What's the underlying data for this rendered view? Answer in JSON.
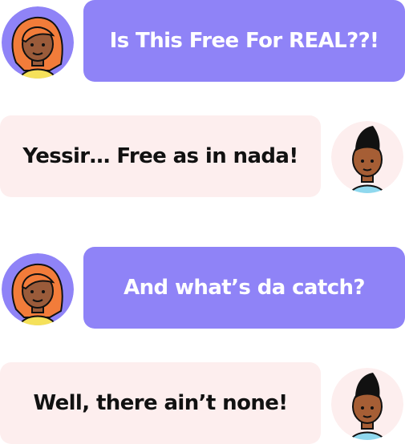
{
  "colors": {
    "girl_bubble": "#8f83f7",
    "boy_bubble": "#fdeeee",
    "girl_avatar_bg": "#8f83f7",
    "boy_avatar_bg": "#fdeeee",
    "girl_text": "#ffffff",
    "boy_text": "#111111"
  },
  "messages": [
    {
      "sender": "girl",
      "avatar_icon": "girl-avatar-icon",
      "text": "Is This Free For REAL??!"
    },
    {
      "sender": "boy",
      "avatar_icon": "boy-avatar-icon",
      "text": "Yessir… Free as in nada!"
    },
    {
      "sender": "girl",
      "avatar_icon": "girl-avatar-icon",
      "text": "And what’s da catch?"
    },
    {
      "sender": "boy",
      "avatar_icon": "boy-avatar-icon",
      "text": "Well, there ain’t none!"
    }
  ]
}
